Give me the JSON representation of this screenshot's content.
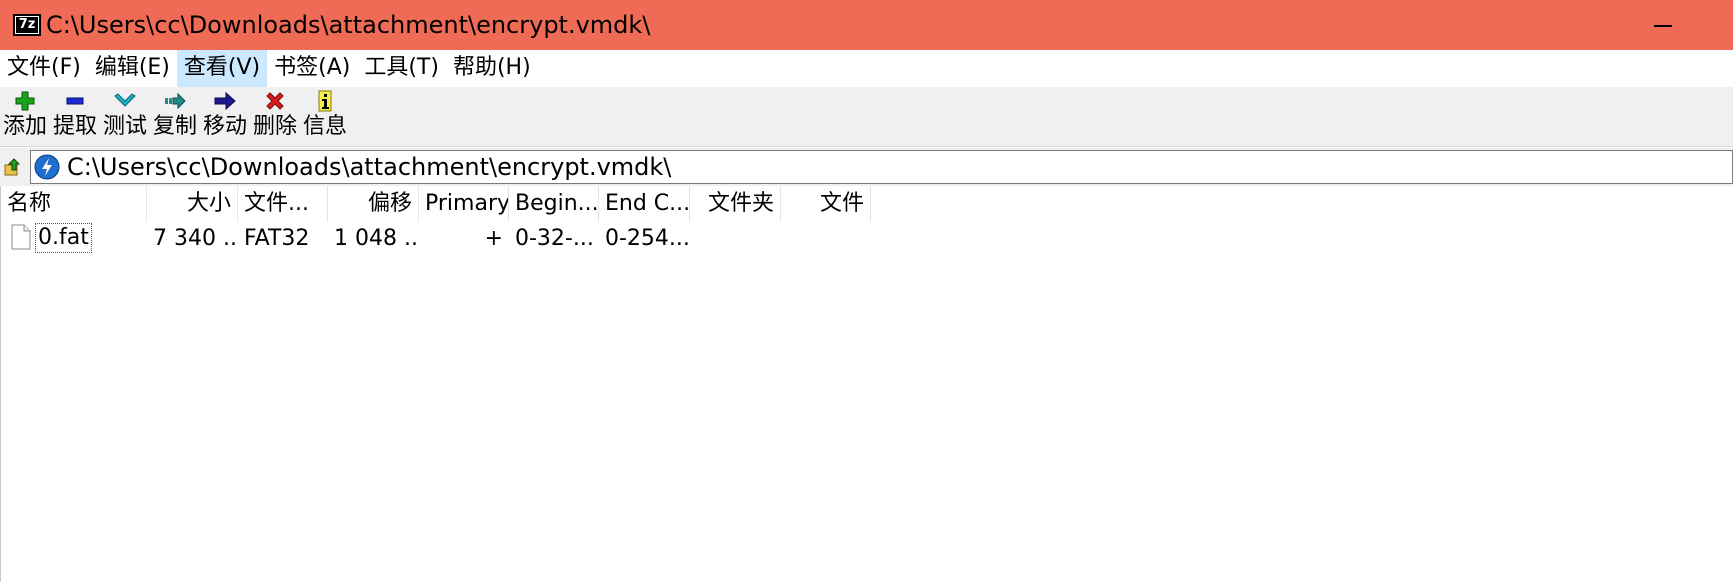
{
  "titlebar": {
    "title": "C:\\Users\\cc\\Downloads\\attachment\\encrypt.vmdk\\",
    "app_icon_text": "7z",
    "background_color": "#f06b55"
  },
  "menu": {
    "items": [
      {
        "label": "文件(F)"
      },
      {
        "label": "编辑(E)"
      },
      {
        "label": "查看(V)",
        "active": true
      },
      {
        "label": "书签(A)"
      },
      {
        "label": "工具(T)"
      },
      {
        "label": "帮助(H)"
      }
    ]
  },
  "toolbar": {
    "buttons": [
      {
        "label": "添加",
        "icon": "plus-icon",
        "color": "#1aa31a"
      },
      {
        "label": "提取",
        "icon": "minus-icon",
        "color": "#1c2bd6"
      },
      {
        "label": "测试",
        "icon": "check-chevron-icon",
        "color": "#17b3c4"
      },
      {
        "label": "复制",
        "icon": "copy-arrow-icon",
        "color": "#1f8c8c"
      },
      {
        "label": "移动",
        "icon": "right-arrow-icon",
        "color": "#1a1a8c"
      },
      {
        "label": "删除",
        "icon": "x-icon",
        "color": "#d91c1c"
      },
      {
        "label": "信息",
        "icon": "info-icon",
        "color": "#d9c71c"
      }
    ]
  },
  "address": {
    "path": "C:\\Users\\cc\\Downloads\\attachment\\encrypt.vmdk\\",
    "up_icon": "folder-up-icon",
    "location_icon": "lightning-disk-icon"
  },
  "columns": [
    {
      "label": "名称"
    },
    {
      "label": "大小"
    },
    {
      "label": "文件..."
    },
    {
      "label": "偏移"
    },
    {
      "label": "Primary"
    },
    {
      "label": "Begin..."
    },
    {
      "label": "End C..."
    },
    {
      "label": "文件夹"
    },
    {
      "label": "文件"
    }
  ],
  "rows": [
    {
      "name": "0.fat",
      "size": "7 340 ...",
      "filesystem": "FAT32",
      "offset": "1 048 ...",
      "primary": "+",
      "begin": "0-32-...",
      "end": "0-254...",
      "folders": "",
      "files": ""
    }
  ]
}
